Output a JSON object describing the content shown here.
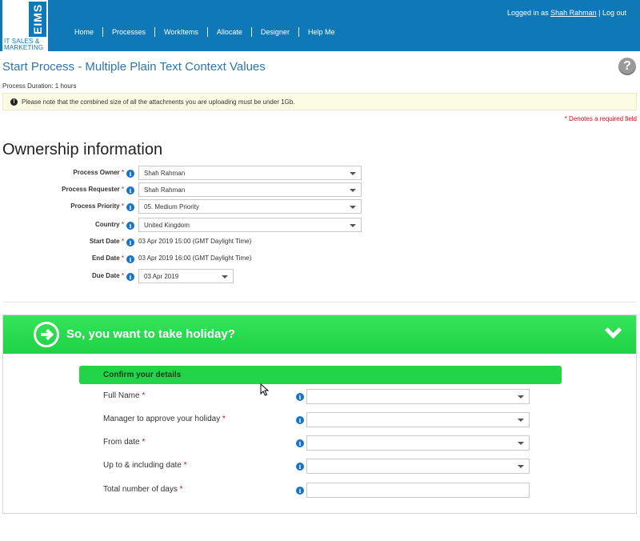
{
  "logo": {
    "mark": "EIMS",
    "line1": "IT SALES &",
    "line2": "MARKETING"
  },
  "nav": [
    "Home",
    "Processes",
    "WorkItems",
    "Allocate",
    "Designer",
    "Help Me"
  ],
  "login": {
    "prefix": "Logged in as ",
    "user": "Shah Rahman",
    "sep": " | ",
    "logout": "Log out"
  },
  "page": {
    "title": "Start Process - Multiple Plain Text Context Values",
    "help": "?",
    "duration": "Process Duration: 1 hours",
    "notice": "Please note that the combined size of all the attachments you are uploading must be under 1Gb.",
    "required_note": "* Denotes a required field"
  },
  "ownership": {
    "title": "Ownership information",
    "fields": {
      "owner": {
        "label": "Process Owner",
        "value": "Shah Rahman"
      },
      "requester": {
        "label": "Process Requester",
        "value": "Shah Rahman"
      },
      "priority": {
        "label": "Process Priority",
        "value": "05. Medium Priority"
      },
      "country": {
        "label": "Country",
        "value": "United Kingdom"
      },
      "start": {
        "label": "Start Date",
        "value": "03 Apr 2019 15:00 (GMT Daylight Time)"
      },
      "end": {
        "label": "End Date",
        "value": "03 Apr 2019 16:00 (GMT Daylight Time)"
      },
      "due": {
        "label": "Due Date",
        "value": "03 Apr 2019"
      }
    },
    "required_mark": "*"
  },
  "holiday": {
    "title": "So, you want to take holiday?",
    "confirm_title": "Confirm your details",
    "fields": {
      "full_name": {
        "label": "Full Name",
        "value": ""
      },
      "manager": {
        "label": "Manager to approve your holiday",
        "value": ""
      },
      "from_date": {
        "label": "From date",
        "value": ""
      },
      "to_date": {
        "label": "Up to & including date",
        "value": ""
      },
      "total_days": {
        "label": "Total number of days",
        "value": ""
      }
    }
  },
  "icons": {
    "help": "question-circle-icon",
    "notice": "info-circle-icon",
    "field_info": "info-icon",
    "banner": "arrow-right-circle-icon",
    "collapse": "chevron-down-icon"
  },
  "colors": {
    "header": "#0e79b6",
    "accent_green": "#22d548",
    "title_blue": "#2f75a8",
    "required_red": "#cc1111"
  }
}
